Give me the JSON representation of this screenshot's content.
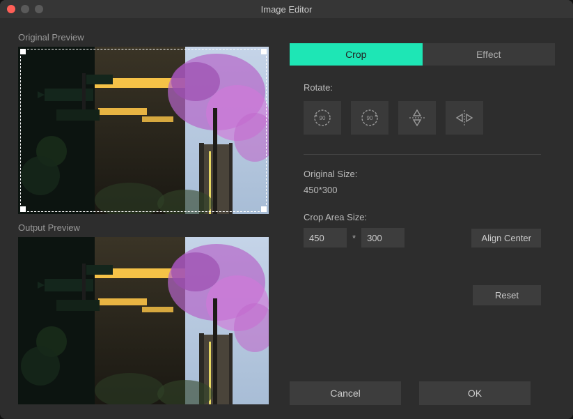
{
  "window": {
    "title": "Image Editor"
  },
  "left": {
    "original_label": "Original Preview",
    "output_label": "Output Preview"
  },
  "tabs": {
    "crop": "Crop",
    "effect": "Effect"
  },
  "rotate": {
    "label": "Rotate:",
    "ccw": "rotate-90-ccw-icon",
    "cw": "rotate-90-cw-icon",
    "flip_v": "flip-vertical-icon",
    "flip_h": "flip-horizontal-icon"
  },
  "original_size": {
    "label": "Original Size:",
    "value": "450*300"
  },
  "crop_area": {
    "label": "Crop Area Size:",
    "width": "450",
    "height": "300",
    "align_center": "Align Center"
  },
  "buttons": {
    "reset": "Reset",
    "cancel": "Cancel",
    "ok": "OK"
  }
}
